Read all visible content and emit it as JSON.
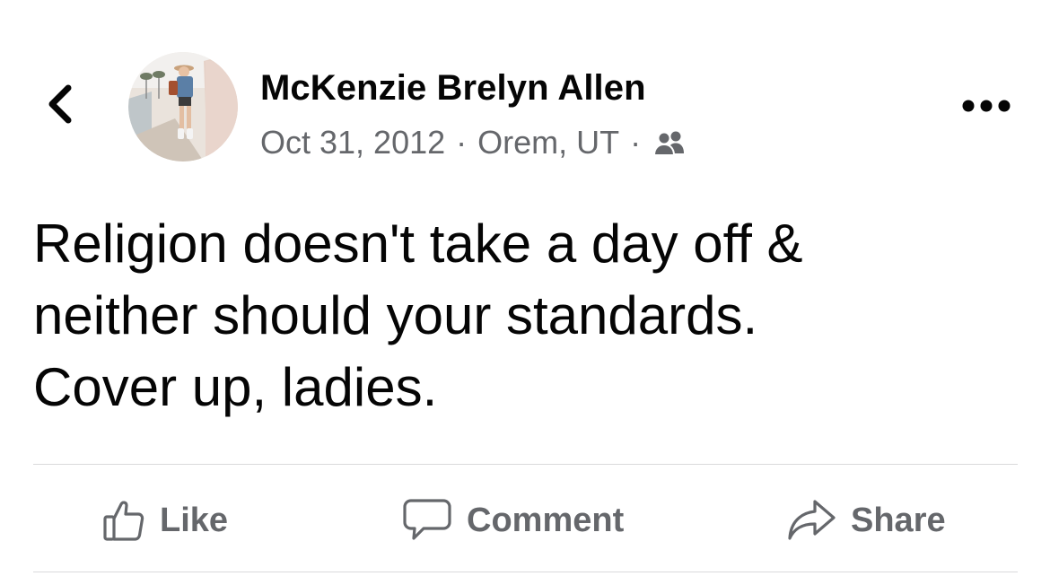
{
  "post": {
    "author_name": "McKenzie Brelyn Allen",
    "date": "Oct 31, 2012",
    "location": "Orem, UT",
    "separator": "·",
    "audience_icon": "friends-icon",
    "text": "Religion doesn't take a day off &\nneither should your standards.\nCover up, ladies."
  },
  "header": {
    "back_icon": "chevron-left-icon",
    "more_icon": "more-horizontal-icon"
  },
  "actions": {
    "like_label": "Like",
    "comment_label": "Comment",
    "share_label": "Share"
  },
  "colors": {
    "primary_text": "#050505",
    "secondary_text": "#65676b",
    "divider": "#d9d9db",
    "background": "#ffffff"
  }
}
